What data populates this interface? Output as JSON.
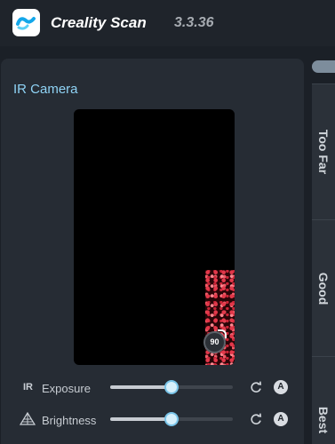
{
  "app": {
    "name": "Creality Scan",
    "version": "3.3.36",
    "logo_icon": "creality-scan-logo-icon",
    "accent": "#8fd3f5"
  },
  "camera_panel": {
    "title": "IR Camera",
    "rotate_label": "90",
    "rotate_icon": "rotate-90-icon"
  },
  "controls": {
    "exposure": {
      "icon_text": "IR",
      "label": "Exposure",
      "value_fraction": 0.5,
      "reset_icon": "refresh-icon",
      "auto_label": "A"
    },
    "brightness": {
      "icon": "brightness-pyramid-icon",
      "label": "Brightness",
      "value_fraction": 0.5,
      "reset_icon": "refresh-icon",
      "auto_label": "A"
    }
  },
  "distance_rail": {
    "items": [
      {
        "label": "Too Far"
      },
      {
        "label": "Good"
      },
      {
        "label": "Best"
      }
    ]
  }
}
